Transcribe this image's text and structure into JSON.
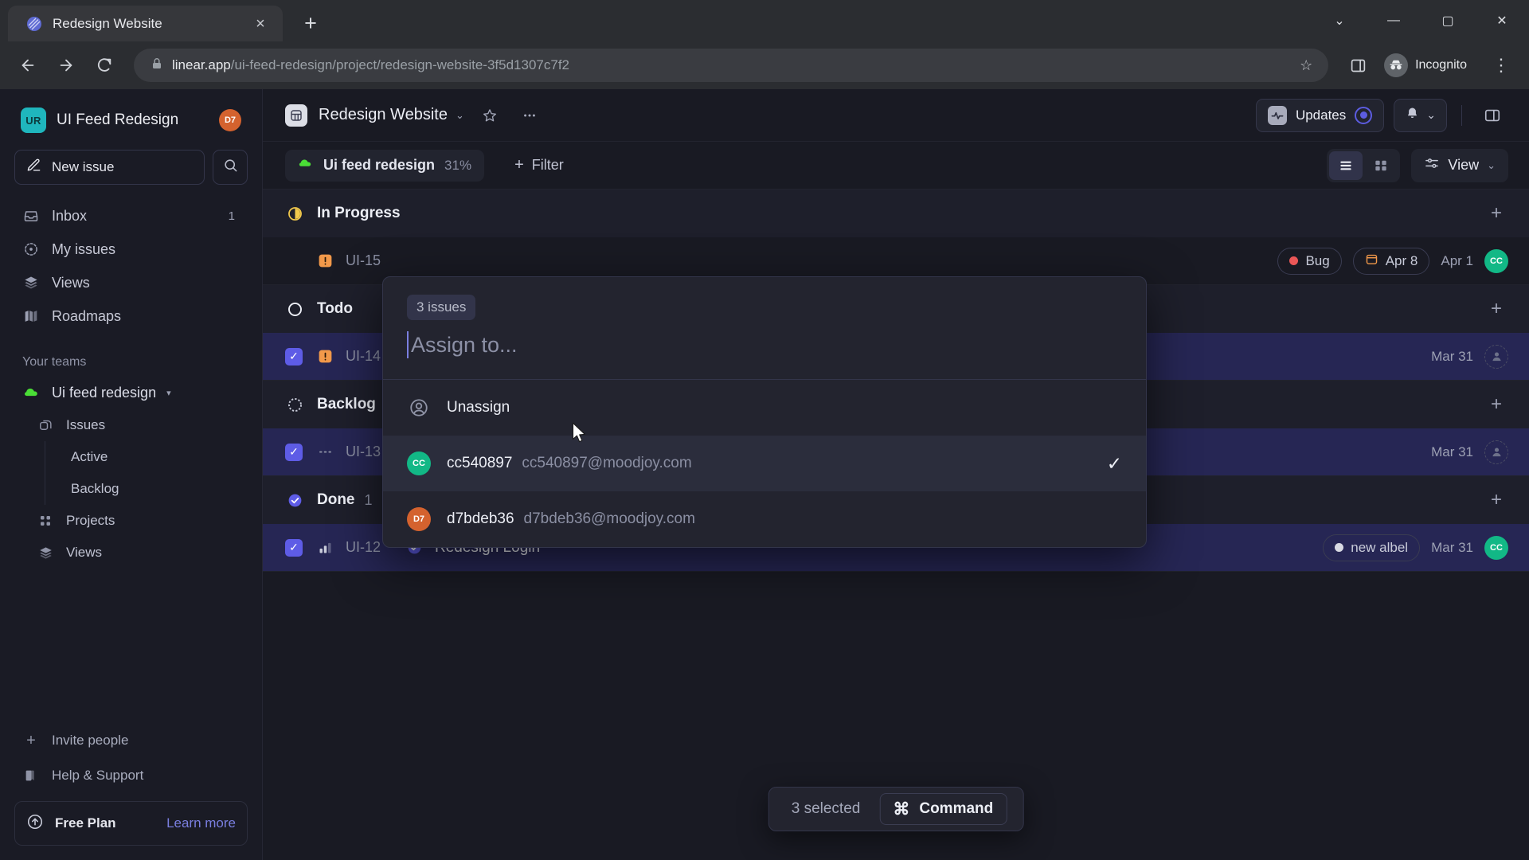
{
  "browser": {
    "tab": {
      "title": "Redesign Website",
      "favicon": "linear-logo-icon",
      "close": "×"
    },
    "new_tab": "+",
    "window_controls": {
      "minimize_all": "⌄",
      "minimize": "—",
      "maximize": "▢",
      "close": "✕"
    },
    "nav": {
      "back": "←",
      "forward": "→",
      "reload": "⟳"
    },
    "omnibox": {
      "lock": "lock-icon",
      "host": "linear.app",
      "path": "/ui-feed-redesign/project/redesign-website-3f5d1307c7f2",
      "bookmark": "☆"
    },
    "profile": {
      "label": "Incognito"
    },
    "menu": "⋮"
  },
  "sidebar": {
    "workspace": {
      "initials": "UR",
      "name": "UI Feed Redesign",
      "user_initials": "D7"
    },
    "new_issue": {
      "label": "New issue",
      "icon": "pencil-square-icon"
    },
    "search": {
      "icon": "search-icon"
    },
    "nav": [
      {
        "label": "Inbox",
        "icon": "inbox-icon",
        "badge": "1"
      },
      {
        "label": "My issues",
        "icon": "target-icon",
        "badge": ""
      },
      {
        "label": "Views",
        "icon": "layers-icon",
        "badge": ""
      },
      {
        "label": "Roadmaps",
        "icon": "map-icon",
        "badge": ""
      }
    ],
    "teams_header": "Your teams",
    "team": {
      "name": "Ui feed redesign",
      "icon": "green-cloud-icon",
      "caret": "▾"
    },
    "team_nav": [
      {
        "label": "Issues",
        "icon": "issues-icon"
      }
    ],
    "team_leaves": [
      {
        "label": "Active"
      },
      {
        "label": "Backlog"
      }
    ],
    "team_nav2": [
      {
        "label": "Projects",
        "icon": "grid-dots-icon"
      },
      {
        "label": "Views",
        "icon": "layers-icon"
      }
    ],
    "footer": [
      {
        "label": "Invite people",
        "icon": "plus-icon"
      },
      {
        "label": "Help & Support",
        "icon": "book-icon"
      }
    ],
    "plan": {
      "icon": "arrow-up-circle-icon",
      "label": "Free Plan",
      "link": "Learn more"
    }
  },
  "header": {
    "project_icon": "project-grid-icon",
    "title": "Redesign Website",
    "chevron": "⌄",
    "favorite_icon": "star-icon",
    "more_icon": "ellipsis-icon",
    "updates": {
      "label": "Updates",
      "icon": "pulse-icon",
      "badge": "status-dot"
    },
    "bell": {
      "icon": "bell-icon",
      "chevron": "⌄"
    },
    "panel_toggle": "sidebar-panel-icon"
  },
  "filter_bar": {
    "project_pill": {
      "icon": "green-cloud-icon",
      "label": "Ui feed redesign",
      "percent": "31%"
    },
    "filter": {
      "plus": "+",
      "label": "Filter"
    },
    "view_list_icon": "list-view-icon",
    "view_board_icon": "board-view-icon",
    "view": {
      "icon": "sliders-icon",
      "label": "View",
      "chevron": "⌄"
    }
  },
  "groups": [
    {
      "name": "In Progress",
      "count": "",
      "icon": "in-progress-icon",
      "add": "+",
      "rows": [
        {
          "id": "UI-15",
          "title": "",
          "selected": false,
          "checkbox": "off",
          "priority_icon": "urgent-icon",
          "status_icon": "",
          "labels": [
            {
              "text": "Bug",
              "color": "#eb5757"
            }
          ],
          "date_chip": {
            "text": "Apr 8",
            "icon": "calendar-icon"
          },
          "date": "Apr 1",
          "avatar": {
            "initials": "CC",
            "color": "#12b886"
          }
        }
      ]
    },
    {
      "name": "Todo",
      "count": "",
      "icon": "todo-icon",
      "add": "+",
      "rows": [
        {
          "id": "UI-14",
          "title": "",
          "selected": true,
          "checkbox": "on",
          "priority_icon": "urgent-icon",
          "status_icon": "",
          "labels": [],
          "date_chip": null,
          "date": "Mar 31",
          "avatar": {
            "initials": "",
            "color": ""
          }
        }
      ]
    },
    {
      "name": "Backlog",
      "count": "",
      "icon": "backlog-icon",
      "add": "+",
      "rows": [
        {
          "id": "UI-13",
          "title": "",
          "selected": true,
          "checkbox": "on",
          "priority_icon": "no-priority-icon",
          "status_icon": "",
          "labels": [],
          "date_chip": null,
          "date": "Mar 31",
          "avatar": {
            "initials": "",
            "color": ""
          }
        }
      ]
    },
    {
      "name": "Done",
      "count": "1",
      "icon": "done-icon",
      "add": "+",
      "rows": [
        {
          "id": "UI-12",
          "title": "Redesign Login",
          "selected": true,
          "checkbox": "on",
          "priority_icon": "medium-priority-icon",
          "status_icon": "done-icon",
          "labels": [
            {
              "text": "new albel",
              "color": "#d8dae3"
            }
          ],
          "date_chip": null,
          "date": "Mar 31",
          "avatar": {
            "initials": "CC",
            "color": "#12b886"
          }
        }
      ]
    }
  ],
  "assign_popover": {
    "issues_badge": "3 issues",
    "input_placeholder": "Assign to...",
    "options": [
      {
        "name": "Unassign",
        "email": "",
        "avatar_icon": "user-circle-icon",
        "avatar_initials": "",
        "avatar_color": "",
        "checked": false,
        "highlighted": false
      },
      {
        "name": "cc540897",
        "email": "cc540897@moodjoy.com",
        "avatar_icon": "",
        "avatar_initials": "CC",
        "avatar_color": "#12b886",
        "checked": true,
        "highlighted": true
      },
      {
        "name": "d7bdeb36",
        "email": "d7bdeb36@moodjoy.com",
        "avatar_icon": "",
        "avatar_initials": "D7",
        "avatar_color": "#d4622e",
        "checked": false,
        "highlighted": false
      }
    ],
    "check_glyph": "✓"
  },
  "command_bar": {
    "count": "3 selected",
    "key_glyph": "⌘",
    "label": "Command"
  }
}
